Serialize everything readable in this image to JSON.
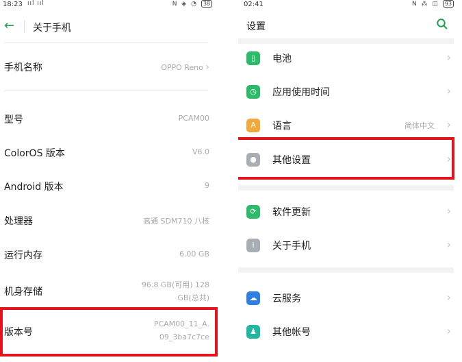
{
  "left": {
    "status": {
      "time": "18:23",
      "signal": "ııl ııl",
      "right_icons": "N ◈ ◔",
      "battery": "38"
    },
    "header": {
      "title": "关于手机"
    },
    "rows": [
      {
        "key": "手机名称",
        "value": "OPPO Reno"
      },
      {
        "key": "型号",
        "value": "PCAM00"
      },
      {
        "key": "ColorOS 版本",
        "value": "V6.0"
      },
      {
        "key": "Android 版本",
        "value": "9"
      },
      {
        "key": "处理器",
        "value": "高通 SDM710 八核"
      },
      {
        "key": "运行内存",
        "value": "6.00 GB"
      },
      {
        "key": "机身存储",
        "value_line1": "96.8 GB(可用) 128",
        "value_line2": "GB(总共)"
      },
      {
        "key": "版本号",
        "value_line1": "PCAM00_11_A.",
        "value_line2": "09_3ba7c7ce"
      }
    ]
  },
  "right": {
    "status": {
      "time": "02:41",
      "right_icons": "N ⁂ ◫",
      "battery": "93"
    },
    "header": {
      "title": "设置"
    },
    "items": [
      {
        "label": "电池",
        "icon": "battery-icon",
        "color": "#2dbb6b"
      },
      {
        "label": "应用使用时间",
        "icon": "app-usage-icon",
        "color": "#2dbb6b"
      },
      {
        "label": "语言",
        "value": "简体中文",
        "icon": "language-icon",
        "color": "#f2a93b"
      },
      {
        "label": "其他设置",
        "icon": "other-settings-icon",
        "color": "#a9adb4"
      },
      {
        "label": "软件更新",
        "icon": "software-update-icon",
        "color": "#2dbb6b"
      },
      {
        "label": "关于手机",
        "icon": "info-icon",
        "color": "#a9adb4"
      },
      {
        "label": "云服务",
        "icon": "cloud-icon",
        "color": "#2f7fe0"
      },
      {
        "label": "其他帐号",
        "icon": "account-icon",
        "color": "#22b5a0"
      }
    ]
  },
  "colors": {
    "accent_green": "#1aa34a",
    "highlight_red": "#e3141e"
  }
}
